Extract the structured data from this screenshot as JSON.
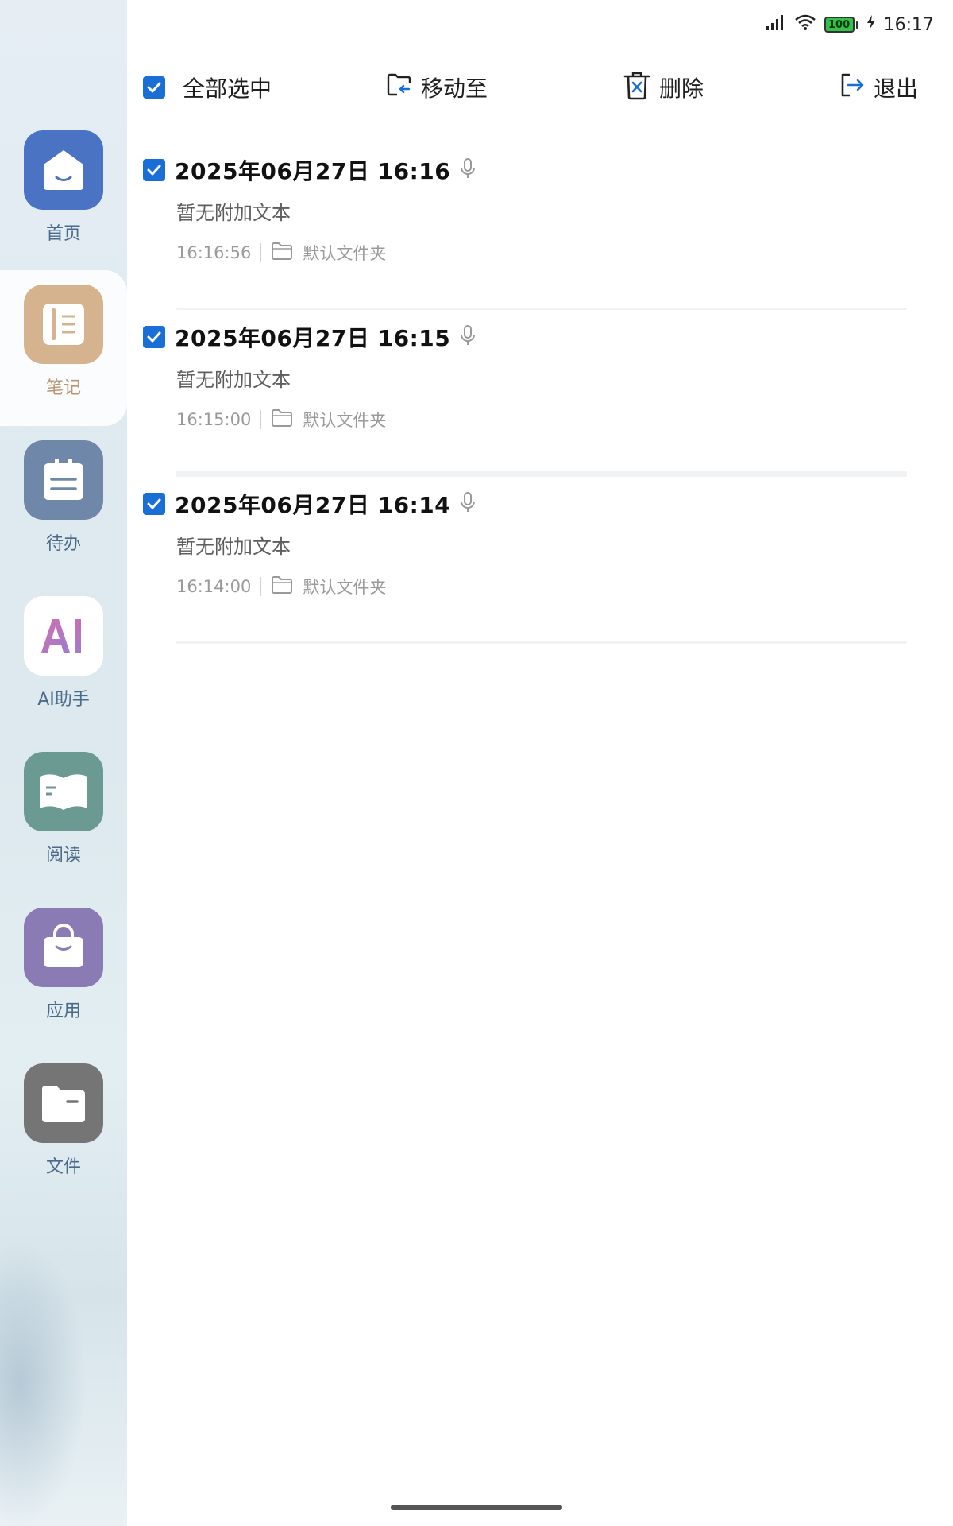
{
  "status_bar": {
    "battery": "100",
    "time": "16:17"
  },
  "toolbar": {
    "select_all_label": "全部选中",
    "move_label": "移动至",
    "delete_label": "删除",
    "exit_label": "退出"
  },
  "sidebar": {
    "items": [
      {
        "label": "首页",
        "icon": "home-icon",
        "color": "#4a73c4"
      },
      {
        "label": "笔记",
        "icon": "notebook-icon",
        "color": "#d6b38f"
      },
      {
        "label": "待办",
        "icon": "todo-icon",
        "color": "#6f88aa"
      },
      {
        "label": "AI助手",
        "icon": "ai-icon",
        "color": "#ffffff"
      },
      {
        "label": "阅读",
        "icon": "book-icon",
        "color": "#6b9a92"
      },
      {
        "label": "应用",
        "icon": "bag-icon",
        "color": "#8b7bb5"
      },
      {
        "label": "文件",
        "icon": "folder-icon",
        "color": "#757575"
      }
    ],
    "active_index": 1
  },
  "notes": [
    {
      "title": "2025年06月27日 16:16",
      "preview": "暂无附加文本",
      "time": "16:16:56",
      "folder": "默认文件夹",
      "checked": true
    },
    {
      "title": "2025年06月27日 16:15",
      "preview": "暂无附加文本",
      "time": "16:15:00",
      "folder": "默认文件夹",
      "checked": true
    },
    {
      "title": "2025年06月27日 16:14",
      "preview": "暂无附加文本",
      "time": "16:14:00",
      "folder": "默认文件夹",
      "checked": true
    }
  ],
  "colors": {
    "accent": "#1a6fd6"
  }
}
